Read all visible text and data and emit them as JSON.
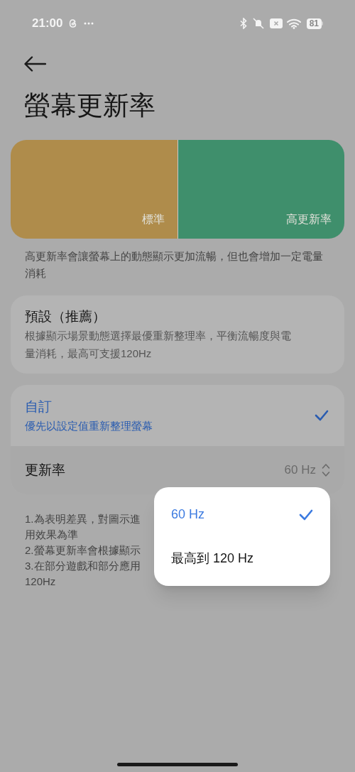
{
  "status_bar": {
    "time": "21:00",
    "battery": "81"
  },
  "title": "螢幕更新率",
  "preview": [
    {
      "label": "標準",
      "color": "#af8c4b"
    },
    {
      "label": "高更新率",
      "color": "#3f8f6c"
    }
  ],
  "description": "高更新率會讓螢幕上的動態顯示更加流暢，但也會增加一定電量消耗",
  "modes": [
    {
      "title": "預設（推薦）",
      "subtitle": "根據顯示場景動態選擇最優重新整理率，平衡流暢度與電量消耗，最高可支援120Hz",
      "selected": false
    },
    {
      "title": "自訂",
      "subtitle": "優先以設定值重新整理螢幕",
      "selected": true
    }
  ],
  "rate_row": {
    "label": "更新率",
    "value": "60 Hz"
  },
  "notes": [
    "1.為表明差異，對圖示進",
    "用效果為準",
    "2.螢幕更新率會根據顯示",
    "3.在部分遊戲和部分應用",
    "120Hz"
  ],
  "menu": [
    {
      "label": "60 Hz",
      "selected": true
    },
    {
      "label": "最高到 120 Hz",
      "selected": false
    }
  ]
}
